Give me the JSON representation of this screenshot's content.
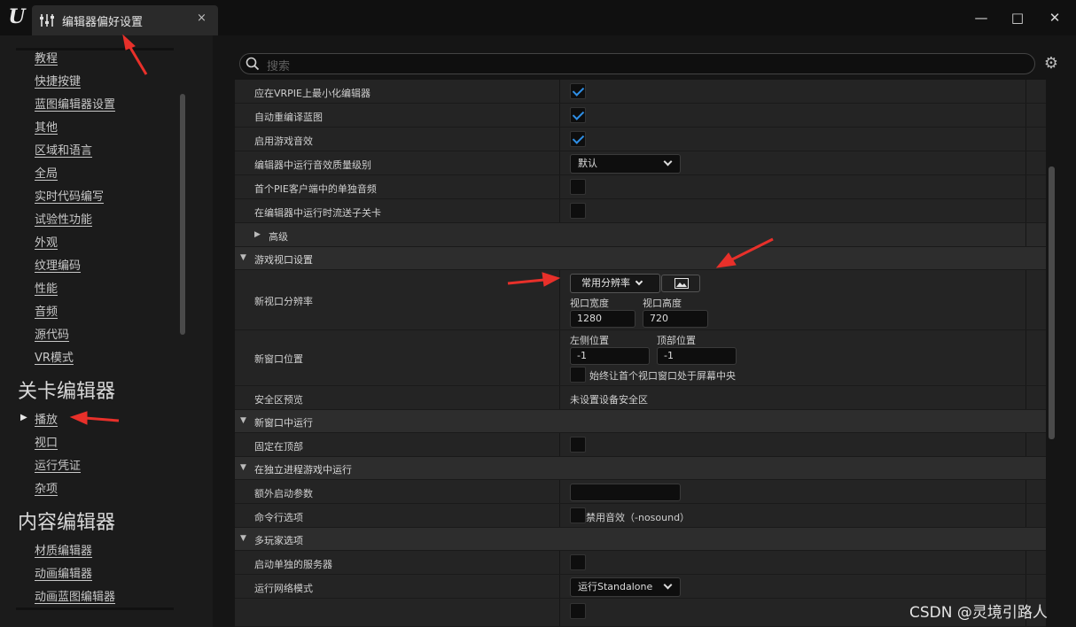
{
  "window": {
    "tab_title": "编辑器偏好设置",
    "tab_close": "×",
    "minimize": "—",
    "maximize": "□",
    "close": "✕"
  },
  "sidebar": {
    "items_top": [
      "教程",
      "快捷按键",
      "蓝图编辑器设置",
      "其他",
      "区域和语言",
      "全局",
      "实时代码编写",
      "试验性功能",
      "外观",
      "纹理编码",
      "性能",
      "音频",
      "源代码",
      "VR模式"
    ],
    "section_level": "关卡编辑器",
    "items_level": [
      "播放",
      "视口",
      "运行凭证",
      "杂项"
    ],
    "section_content": "内容编辑器",
    "items_content": [
      "材质编辑器",
      "动画编辑器",
      "动画蓝图编辑器"
    ]
  },
  "search": {
    "placeholder": "搜索"
  },
  "rows": {
    "vrpie": "应在VRPIE上最小化编辑器",
    "recompile": "自动重编译蓝图",
    "game_audio": "启用游戏音效",
    "audio_quality": "编辑器中运行音效质量级别",
    "audio_quality_value": "默认",
    "pie_solo_audio": "首个PIE客户端中的单独音频",
    "stream_sublevels": "在编辑器中运行时流送子关卡",
    "advanced": "高级"
  },
  "game_viewport": {
    "category": "游戏视口设置",
    "new_res_label": "新视口分辨率",
    "common_res_button": "常用分辨率",
    "width_label": "视口宽度",
    "height_label": "视口高度",
    "width_value": "1280",
    "height_value": "720",
    "new_pos_label": "新窗口位置",
    "left_label": "左侧位置",
    "top_label": "顶部位置",
    "left_value": "-1",
    "top_value": "-1",
    "center_label": "始终让首个视口窗口处于屏幕中央",
    "safe_zone_label": "安全区预览",
    "safe_zone_value": "未设置设备安全区"
  },
  "new_window": {
    "category": "新窗口中运行",
    "always_on_top": "固定在顶部"
  },
  "standalone": {
    "category": "在独立进程游戏中运行",
    "extra_args": "额外启动参数",
    "cmd_options": "命令行选项",
    "disable_sound": "禁用音效（-nosound）"
  },
  "multiplayer": {
    "category": "多玩家选项",
    "single_server": "启动单独的服务器",
    "net_mode": "运行网络模式",
    "net_mode_value": "运行Standalone"
  },
  "watermark": "CSDN @灵境引路人",
  "colors": {
    "accent_check": "#2f8fe6",
    "arrow_red": "#e8302a"
  }
}
